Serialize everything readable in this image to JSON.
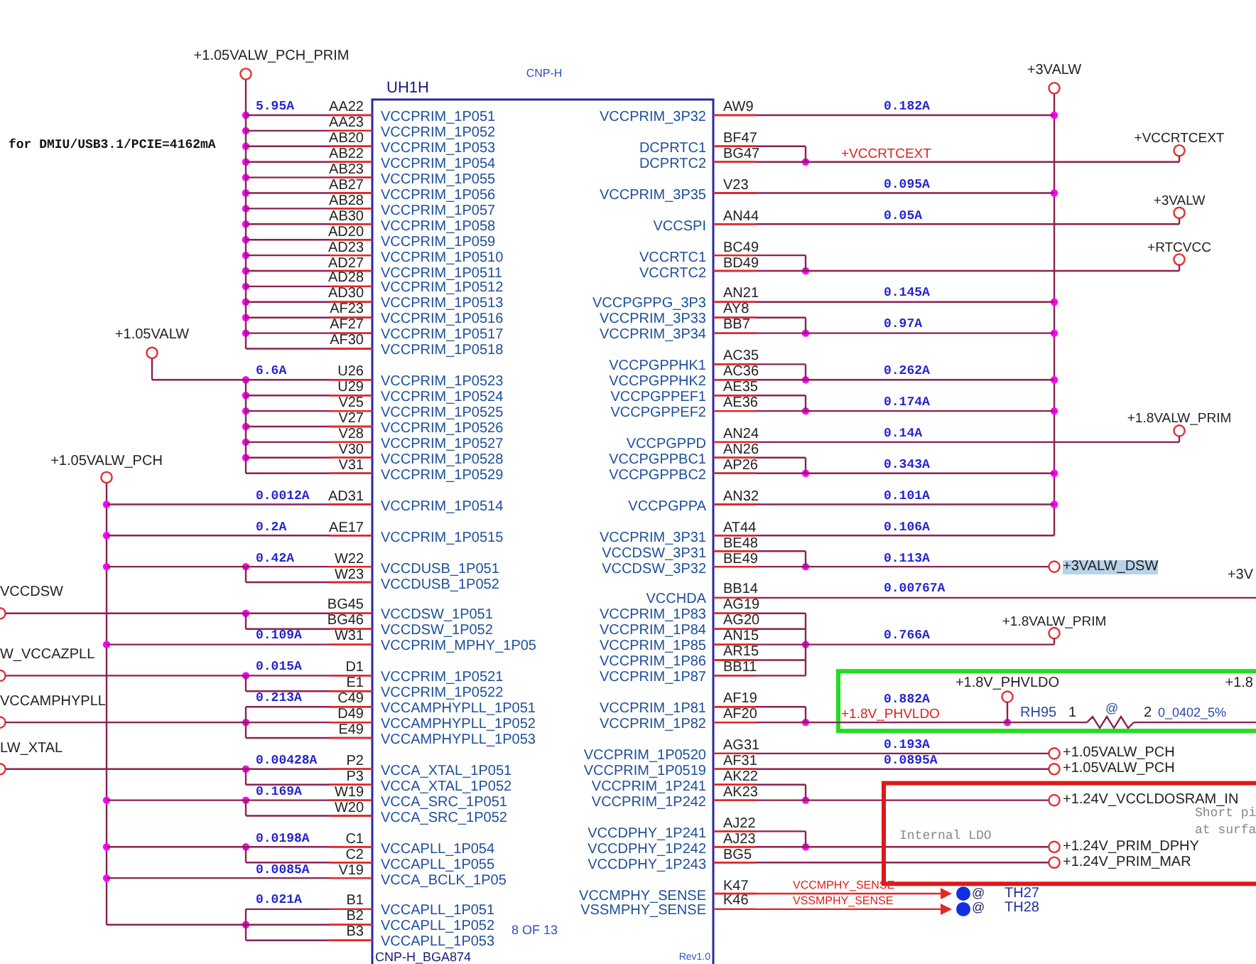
{
  "chip": {
    "type": "CNP-H",
    "ref": "UH1H",
    "page": "8 OF 13",
    "footprint": "CNP-H_BGA874",
    "rev": "Rev1.0"
  },
  "left_bus": {
    "label": "+1.05VALW_PCH"
  },
  "right_bus": {
    "label": "+3VALW"
  },
  "left_blocks": [
    [
      {
        "source": {
          "kind": "top-rail",
          "label": "+1.05VALW_PCH_PRIM"
        },
        "current": "5.95A",
        "note": "for DMIU/USB3.1/PCIE=4162mA",
        "pins": [
          {
            "pin": "AA22",
            "name": "VCCPRIM_1P051"
          },
          {
            "pin": "AA23",
            "name": "VCCPRIM_1P052"
          },
          {
            "pin": "AB20",
            "name": "VCCPRIM_1P053"
          },
          {
            "pin": "AB22",
            "name": "VCCPRIM_1P054"
          },
          {
            "pin": "AB23",
            "name": "VCCPRIM_1P055"
          },
          {
            "pin": "AB27",
            "name": "VCCPRIM_1P056"
          },
          {
            "pin": "AB28",
            "name": "VCCPRIM_1P057"
          },
          {
            "pin": "AB30",
            "name": "VCCPRIM_1P058"
          },
          {
            "pin": "AD20",
            "name": "VCCPRIM_1P059"
          },
          {
            "pin": "AD23",
            "name": "VCCPRIM_1P0510"
          },
          {
            "pin": "AD27",
            "name": "VCCPRIM_1P0511"
          },
          {
            "pin": "AD28",
            "name": "VCCPRIM_1P0512"
          },
          {
            "pin": "AD30",
            "name": "VCCPRIM_1P0513"
          },
          {
            "pin": "AF23",
            "name": "VCCPRIM_1P0516"
          },
          {
            "pin": "AF27",
            "name": "VCCPRIM_1P0517"
          },
          {
            "pin": "AF30",
            "name": "VCCPRIM_1P0518"
          }
        ]
      }
    ],
    [
      {
        "source": {
          "kind": "side-rail",
          "label": "+1.05VALW"
        },
        "current": "6.6A",
        "pins": [
          {
            "pin": "U26",
            "name": "VCCPRIM_1P0523"
          },
          {
            "pin": "U29",
            "name": "VCCPRIM_1P0524"
          },
          {
            "pin": "V25",
            "name": "VCCPRIM_1P0525"
          },
          {
            "pin": "V27",
            "name": "VCCPRIM_1P0526"
          },
          {
            "pin": "V28",
            "name": "VCCPRIM_1P0527"
          },
          {
            "pin": "V30",
            "name": "VCCPRIM_1P0528"
          },
          {
            "pin": "V31",
            "name": "VCCPRIM_1P0529"
          }
        ]
      }
    ],
    [
      {
        "source": {
          "kind": "bus"
        },
        "current": "0.0012A",
        "pins": [
          {
            "pin": "AD31",
            "name": "VCCPRIM_1P0514"
          }
        ]
      }
    ],
    [
      {
        "source": {
          "kind": "bus"
        },
        "current": "0.2A",
        "pins": [
          {
            "pin": "AE17",
            "name": "VCCPRIM_1P0515"
          }
        ]
      }
    ],
    [
      {
        "source": {
          "kind": "bus"
        },
        "current": "0.42A",
        "pins": [
          {
            "pin": "W22",
            "name": "VCCDUSB_1P051"
          },
          {
            "pin": "W23",
            "name": "VCCDUSB_1P052"
          }
        ]
      }
    ],
    [
      {
        "source": {
          "kind": "edge",
          "label": "VCCDSW"
        },
        "pins": [
          {
            "pin": "BG45",
            "name": "VCCDSW_1P051"
          },
          {
            "pin": "BG46",
            "name": "VCCDSW_1P052"
          }
        ]
      },
      {
        "source": {
          "kind": "bus"
        },
        "current": "0.109A",
        "pins": [
          {
            "pin": "W31",
            "name": "VCCPRIM_MPHY_1P05"
          }
        ]
      }
    ],
    [
      {
        "source": {
          "kind": "edge",
          "label": "W_VCCAZPLL"
        },
        "current": "0.015A",
        "pins": [
          {
            "pin": "D1",
            "name": "VCCPRIM_1P0521"
          },
          {
            "pin": "E1",
            "name": "VCCPRIM_1P0522"
          }
        ]
      },
      {
        "source": {
          "kind": "edge",
          "label": "VCCAMPHYPLL"
        },
        "current": "0.213A",
        "pins": [
          {
            "pin": "C49",
            "name": "VCCAMPHYPLL_1P051"
          },
          {
            "pin": "D49",
            "name": "VCCAMPHYPLL_1P052"
          },
          {
            "pin": "E49",
            "name": "VCCAMPHYPLL_1P053"
          }
        ]
      }
    ],
    [
      {
        "source": {
          "kind": "edge",
          "label": "LW_XTAL"
        },
        "current": "0.00428A",
        "pins": [
          {
            "pin": "P2",
            "name": "VCCA_XTAL_1P051"
          },
          {
            "pin": "P3",
            "name": "VCCA_XTAL_1P052"
          }
        ]
      },
      {
        "source": {
          "kind": "bus"
        },
        "current": "0.169A",
        "pins": [
          {
            "pin": "W19",
            "name": "VCCA_SRC_1P051"
          },
          {
            "pin": "W20",
            "name": "VCCA_SRC_1P052"
          }
        ]
      }
    ],
    [
      {
        "source": {
          "kind": "bus"
        },
        "current": "0.0198A",
        "pins": [
          {
            "pin": "C1",
            "name": "VCCAPLL_1P054"
          },
          {
            "pin": "C2",
            "name": "VCCAPLL_1P055"
          }
        ]
      },
      {
        "source": {
          "kind": "bus"
        },
        "current": "0.0085A",
        "pins": [
          {
            "pin": "V19",
            "name": "VCCA_BCLK_1P05"
          }
        ]
      }
    ],
    [
      {
        "source": {
          "kind": "bus"
        },
        "current": "0.021A",
        "pins": [
          {
            "pin": "B1",
            "name": "VCCAPLL_1P051"
          },
          {
            "pin": "B2",
            "name": "VCCAPLL_1P052"
          },
          {
            "pin": "B3",
            "name": "VCCAPLL_1P053"
          }
        ]
      }
    ]
  ],
  "right_blocks": [
    [
      {
        "current": "0.182A",
        "dest": {
          "kind": "bus"
        },
        "pins": [
          {
            "pin": "AW9",
            "name": "VCCPRIM_3P32"
          }
        ]
      }
    ],
    [
      {
        "net_label": "+VCCRTCEXT",
        "dest": {
          "kind": "flag",
          "label": "+VCCRTCEXT"
        },
        "pins": [
          {
            "pin": "BF47",
            "name": "DCPRTC1"
          },
          {
            "pin": "BG47",
            "name": "DCPRTC2"
          }
        ]
      }
    ],
    [
      {
        "current": "0.095A",
        "dest": {
          "kind": "bus"
        },
        "pins": [
          {
            "pin": "V23",
            "name": "VCCPRIM_3P35"
          }
        ]
      }
    ],
    [
      {
        "current": "0.05A",
        "dest": {
          "kind": "flag",
          "label": "+3VALW"
        },
        "pins": [
          {
            "pin": "AN44",
            "name": "VCCSPI"
          }
        ]
      }
    ],
    [
      {
        "dest": {
          "kind": "flag",
          "label": "+RTCVCC"
        },
        "pins": [
          {
            "pin": "BC49",
            "name": "VCCRTC1"
          },
          {
            "pin": "BD49",
            "name": "VCCRTC2"
          }
        ]
      }
    ],
    [
      {
        "current": "0.145A",
        "dest": {
          "kind": "bus"
        },
        "pins": [
          {
            "pin": "AN21",
            "name": "VCCPGPPG_3P3"
          }
        ]
      },
      {
        "current": "0.97A",
        "dest": {
          "kind": "bus"
        },
        "pins": [
          {
            "pin": "AY8",
            "name": "VCCPRIM_3P33"
          },
          {
            "pin": "BB7",
            "name": "VCCPRIM_3P34"
          }
        ]
      }
    ],
    [
      {
        "current": "0.262A",
        "dest": {
          "kind": "bus"
        },
        "pins": [
          {
            "pin": "AC35",
            "name": "VCCPGPPHK1"
          },
          {
            "pin": "AC36",
            "name": "VCCPGPPHK2"
          }
        ]
      },
      {
        "current": "0.174A",
        "dest": {
          "kind": "bus"
        },
        "pins": [
          {
            "pin": "AE35",
            "name": "VCCPGPPEF1"
          },
          {
            "pin": "AE36",
            "name": "VCCPGPPEF2"
          }
        ]
      }
    ],
    [
      {
        "current": "0.14A",
        "dest": {
          "kind": "flag",
          "label": "+1.8VALW_PRIM"
        },
        "pins": [
          {
            "pin": "AN24",
            "name": "VCCPGPPD"
          }
        ]
      },
      {
        "current": "0.343A",
        "dest": {
          "kind": "bus"
        },
        "pins": [
          {
            "pin": "AN26",
            "name": "VCCPGPPBC1"
          },
          {
            "pin": "AP26",
            "name": "VCCPGPPBC2"
          }
        ]
      }
    ],
    [
      {
        "current": "0.101A",
        "dest": {
          "kind": "bus"
        },
        "pins": [
          {
            "pin": "AN32",
            "name": "VCCPGPPA"
          }
        ]
      }
    ],
    [
      {
        "current": "0.106A",
        "dest": {
          "kind": "bus"
        },
        "pins": [
          {
            "pin": "AT44",
            "name": "VCCPRIM_3P31"
          }
        ]
      },
      {
        "current": "0.113A",
        "dest": {
          "kind": "connector",
          "label": "+3VALW_DSW",
          "highlighted": true
        },
        "pins": [
          {
            "pin": "BE48",
            "name": "VCCDSW_3P31"
          },
          {
            "pin": "BE49",
            "name": "VCCDSW_3P32"
          }
        ]
      }
    ],
    [
      {
        "current": "0.00767A",
        "dest": {
          "kind": "edge",
          "label": "+3V"
        },
        "pins": [
          {
            "pin": "BB14",
            "name": "VCCHDA"
          }
        ]
      },
      {
        "current": "0.766A",
        "dest": {
          "kind": "flag-inner",
          "label": "+1.8VALW_PRIM"
        },
        "pins": [
          {
            "pin": "AG19",
            "name": "VCCPRIM_1P83"
          },
          {
            "pin": "AG20",
            "name": "VCCPRIM_1P84"
          },
          {
            "pin": "AN15",
            "name": "VCCPRIM_1P85"
          },
          {
            "pin": "AR15",
            "name": "VCCPRIM_1P86"
          },
          {
            "pin": "BB11",
            "name": "VCCPRIM_1P87"
          }
        ]
      }
    ],
    [
      {
        "current": "0.882A",
        "net_label": "+1.8V_PHVLDO",
        "dest": {
          "kind": "resistor",
          "flag_label": "+1.8V_PHVLDO",
          "ref": "RH95",
          "pin_a": "1",
          "mark": "@",
          "pin_b": "2",
          "value": "0_0402_5%",
          "out_label": "+1.8"
        },
        "pins": [
          {
            "pin": "AF19",
            "name": "VCCPRIM_1P81"
          },
          {
            "pin": "AF20",
            "name": "VCCPRIM_1P82"
          }
        ]
      }
    ],
    [
      {
        "current": "0.193A",
        "dest": {
          "kind": "connector",
          "label": "+1.05VALW_PCH"
        },
        "pins": [
          {
            "pin": "AG31",
            "name": "VCCPRIM_1P0520"
          }
        ]
      },
      {
        "current": "0.0895A",
        "dest": {
          "kind": "connector",
          "label": "+1.05VALW_PCH"
        },
        "pins": [
          {
            "pin": "AF31",
            "name": "VCCPRIM_1P0519"
          }
        ]
      },
      {
        "dest": {
          "kind": "ldo",
          "label": "+1.24V_VCCLDOSRAM_IN"
        },
        "pins": [
          {
            "pin": "AK22",
            "name": "VCCPRIM_1P241"
          },
          {
            "pin": "AK23",
            "name": "VCCPRIM_1P242"
          }
        ]
      }
    ],
    [
      {
        "dest": {
          "kind": "ldo",
          "label": "+1.24V_PRIM_DPHY"
        },
        "pins": [
          {
            "pin": "AJ22",
            "name": "VCCDPHY_1P241"
          },
          {
            "pin": "AJ23",
            "name": "VCCDPHY_1P242"
          }
        ]
      },
      {
        "dest": {
          "kind": "ldo",
          "label": "+1.24V_PRIM_MAR"
        },
        "pins": [
          {
            "pin": "BG5",
            "name": "VCCDPHY_1P243"
          }
        ]
      }
    ],
    [
      {
        "net_label": "VCCMPHY_SENSE",
        "dest": {
          "kind": "testpoint",
          "ref": "TH27",
          "mark": "@"
        },
        "pins": [
          {
            "pin": "K47",
            "name": "VCCMPHY_SENSE"
          }
        ]
      },
      {
        "net_label": "VSSMPHY_SENSE",
        "dest": {
          "kind": "testpoint",
          "ref": "TH28",
          "mark": "@"
        },
        "pins": [
          {
            "pin": "K46",
            "name": "VSSMPHY_SENSE"
          }
        ]
      }
    ]
  ],
  "ldo_frame": {
    "label": "Internal LDO",
    "note": [
      "Short pi",
      "at surfa"
    ]
  }
}
